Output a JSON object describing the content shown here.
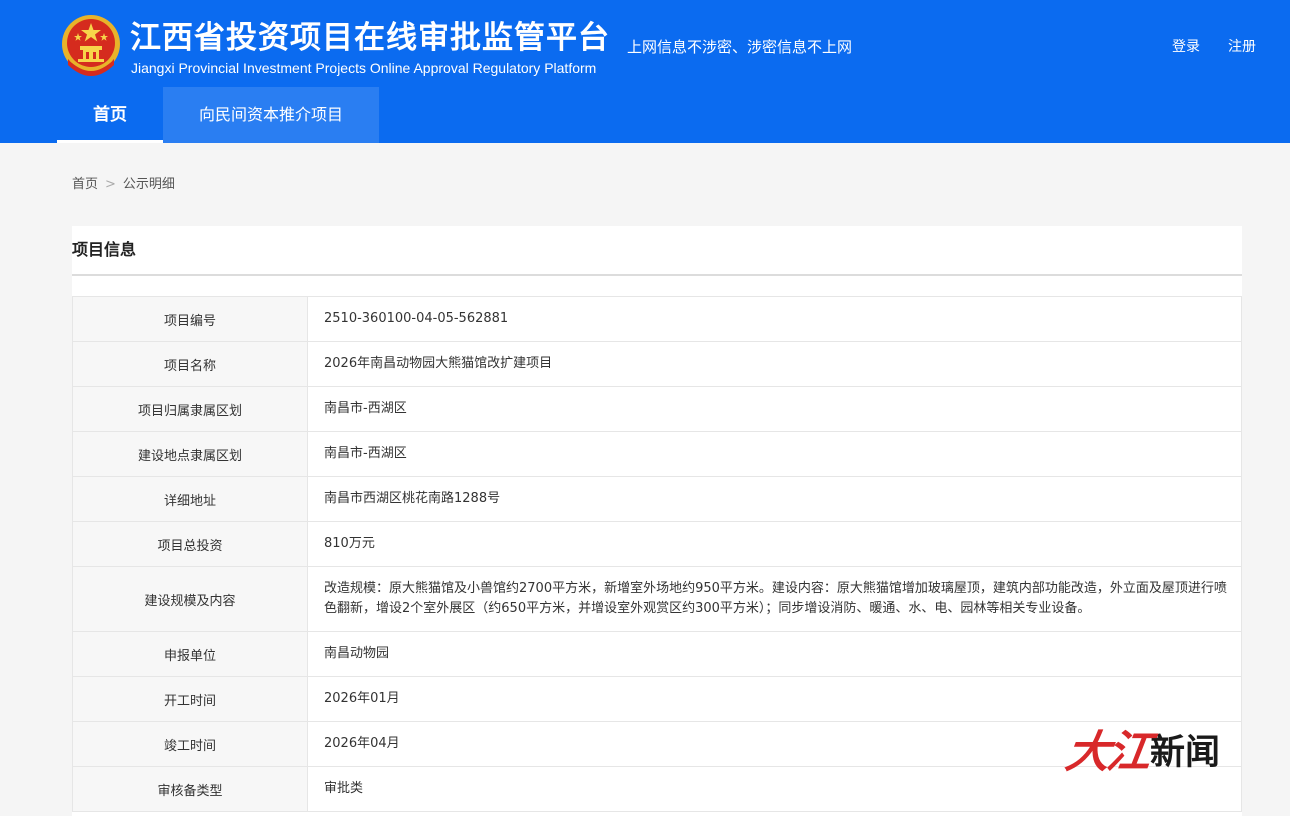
{
  "header": {
    "title": "江西省投资项目在线审批监管平台",
    "subtitle_en": "Jiangxi Provincial Investment Projects Online Approval Regulatory Platform",
    "slogan": "上网信息不涉密、涉密信息不上网",
    "login": "登录",
    "register": "注册",
    "primary_color": "#0b6bf0"
  },
  "nav": {
    "home": "首页",
    "projects": "向民间资本推介项目"
  },
  "breadcrumb": {
    "home": "首页",
    "separator": ">",
    "current": "公示明细"
  },
  "panel": {
    "title": "项目信息"
  },
  "rows": [
    {
      "label": "项目编号",
      "value": "2510-360100-04-05-562881"
    },
    {
      "label": "项目名称",
      "value": "2026年南昌动物园大熊猫馆改扩建项目"
    },
    {
      "label": "项目归属隶属区划",
      "value": "南昌市-西湖区"
    },
    {
      "label": "建设地点隶属区划",
      "value": "南昌市-西湖区"
    },
    {
      "label": "详细地址",
      "value": "南昌市西湖区桃花南路1288号"
    },
    {
      "label": "项目总投资",
      "value": "810万元"
    },
    {
      "label": "建设规模及内容",
      "value": "改造规模：原大熊猫馆及小兽馆约2700平方米，新增室外场地约950平方米。建设内容：原大熊猫馆增加玻璃屋顶，建筑内部功能改造，外立面及屋顶进行喷色翻新，增设2个室外展区（约650平方米，并增设室外观赏区约300平方米）；同步增设消防、暖通、水、电、园林等相关专业设备。"
    },
    {
      "label": "申报单位",
      "value": "南昌动物园"
    },
    {
      "label": "开工时间",
      "value": "2026年01月"
    },
    {
      "label": "竣工时间",
      "value": "2026年04月"
    },
    {
      "label": "审核备类型",
      "value": "审批类"
    }
  ],
  "watermark": {
    "logo": "大江",
    "news": "新闻"
  }
}
